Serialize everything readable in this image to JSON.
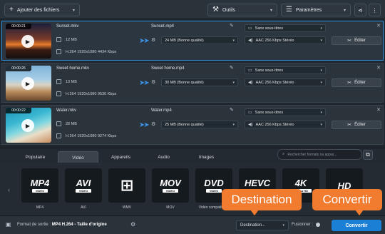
{
  "toolbar": {
    "add_files": "Ajouter des fichiers",
    "tools": "Outils",
    "settings": "Paramètres"
  },
  "files": [
    {
      "duration": "00:00:21",
      "name": "Sunset.mkv",
      "size": "12 MB",
      "codec": "H.264 1920x1080 4434 Kbps",
      "out_name": "Sunset.mp4",
      "out_size": "24 MB (Bonne qualité)",
      "subtitles": "Sans sous-titres",
      "audio": "AAC 256 Kbps Stéréo",
      "edit": "Éditer"
    },
    {
      "duration": "00:00:26",
      "name": "Sweet home.mkv",
      "size": "13 MB",
      "codec": "H.264 1920x1080 9530 Kbps",
      "out_name": "Sweet home.mp4",
      "out_size": "30 MB (Bonne qualité)",
      "subtitles": "Sans sous-titres",
      "audio": "AAC 256 Kbps Stéréo",
      "edit": "Éditer"
    },
    {
      "duration": "00:00:22",
      "name": "Water.mkv",
      "size": "26 MB",
      "codec": "H.264 1920x1080 9274 Kbps",
      "out_name": "Water.mp4",
      "out_size": "25 MB (Bonne qualité)",
      "subtitles": "Sans sous-titres",
      "audio": "AAC 256 Kbps Stéréo",
      "edit": "Éditer"
    }
  ],
  "tabs": [
    "Populaire",
    "Vidéo",
    "Appareils",
    "Audio",
    "Images"
  ],
  "search_placeholder": "Rechercher formats ou appar...",
  "formats": [
    {
      "big": "MP4",
      "bar": "VIDEO",
      "label": "MP4"
    },
    {
      "big": "AVI",
      "bar": "VIDEO",
      "label": "AVI"
    },
    {
      "big": "",
      "bar": "",
      "label": "WMV"
    },
    {
      "big": "MOV",
      "bar": "VIDEO",
      "label": "MOV"
    },
    {
      "big": "DVD",
      "bar": "VIDEO",
      "label": "Vidéo compatible..."
    },
    {
      "big": "HEVC",
      "bar": "H.265",
      "label": ""
    },
    {
      "big": "4K",
      "bar": "ULTRA HD",
      "label": ""
    },
    {
      "big": "HD",
      "bar": "",
      "label": ""
    }
  ],
  "callouts": {
    "destination": "Destination",
    "convert": "Convertir"
  },
  "bottom": {
    "format_label": "Format de sortie :",
    "format_value": "MP4 H.264 - Taille d'origine",
    "destination": "Destination...",
    "merge": "Fusionner :",
    "convert": "Convertir"
  },
  "colors": {
    "accent": "#1c7fd6",
    "callout": "#f17b2f",
    "selected_border": "#2f8fd8"
  }
}
